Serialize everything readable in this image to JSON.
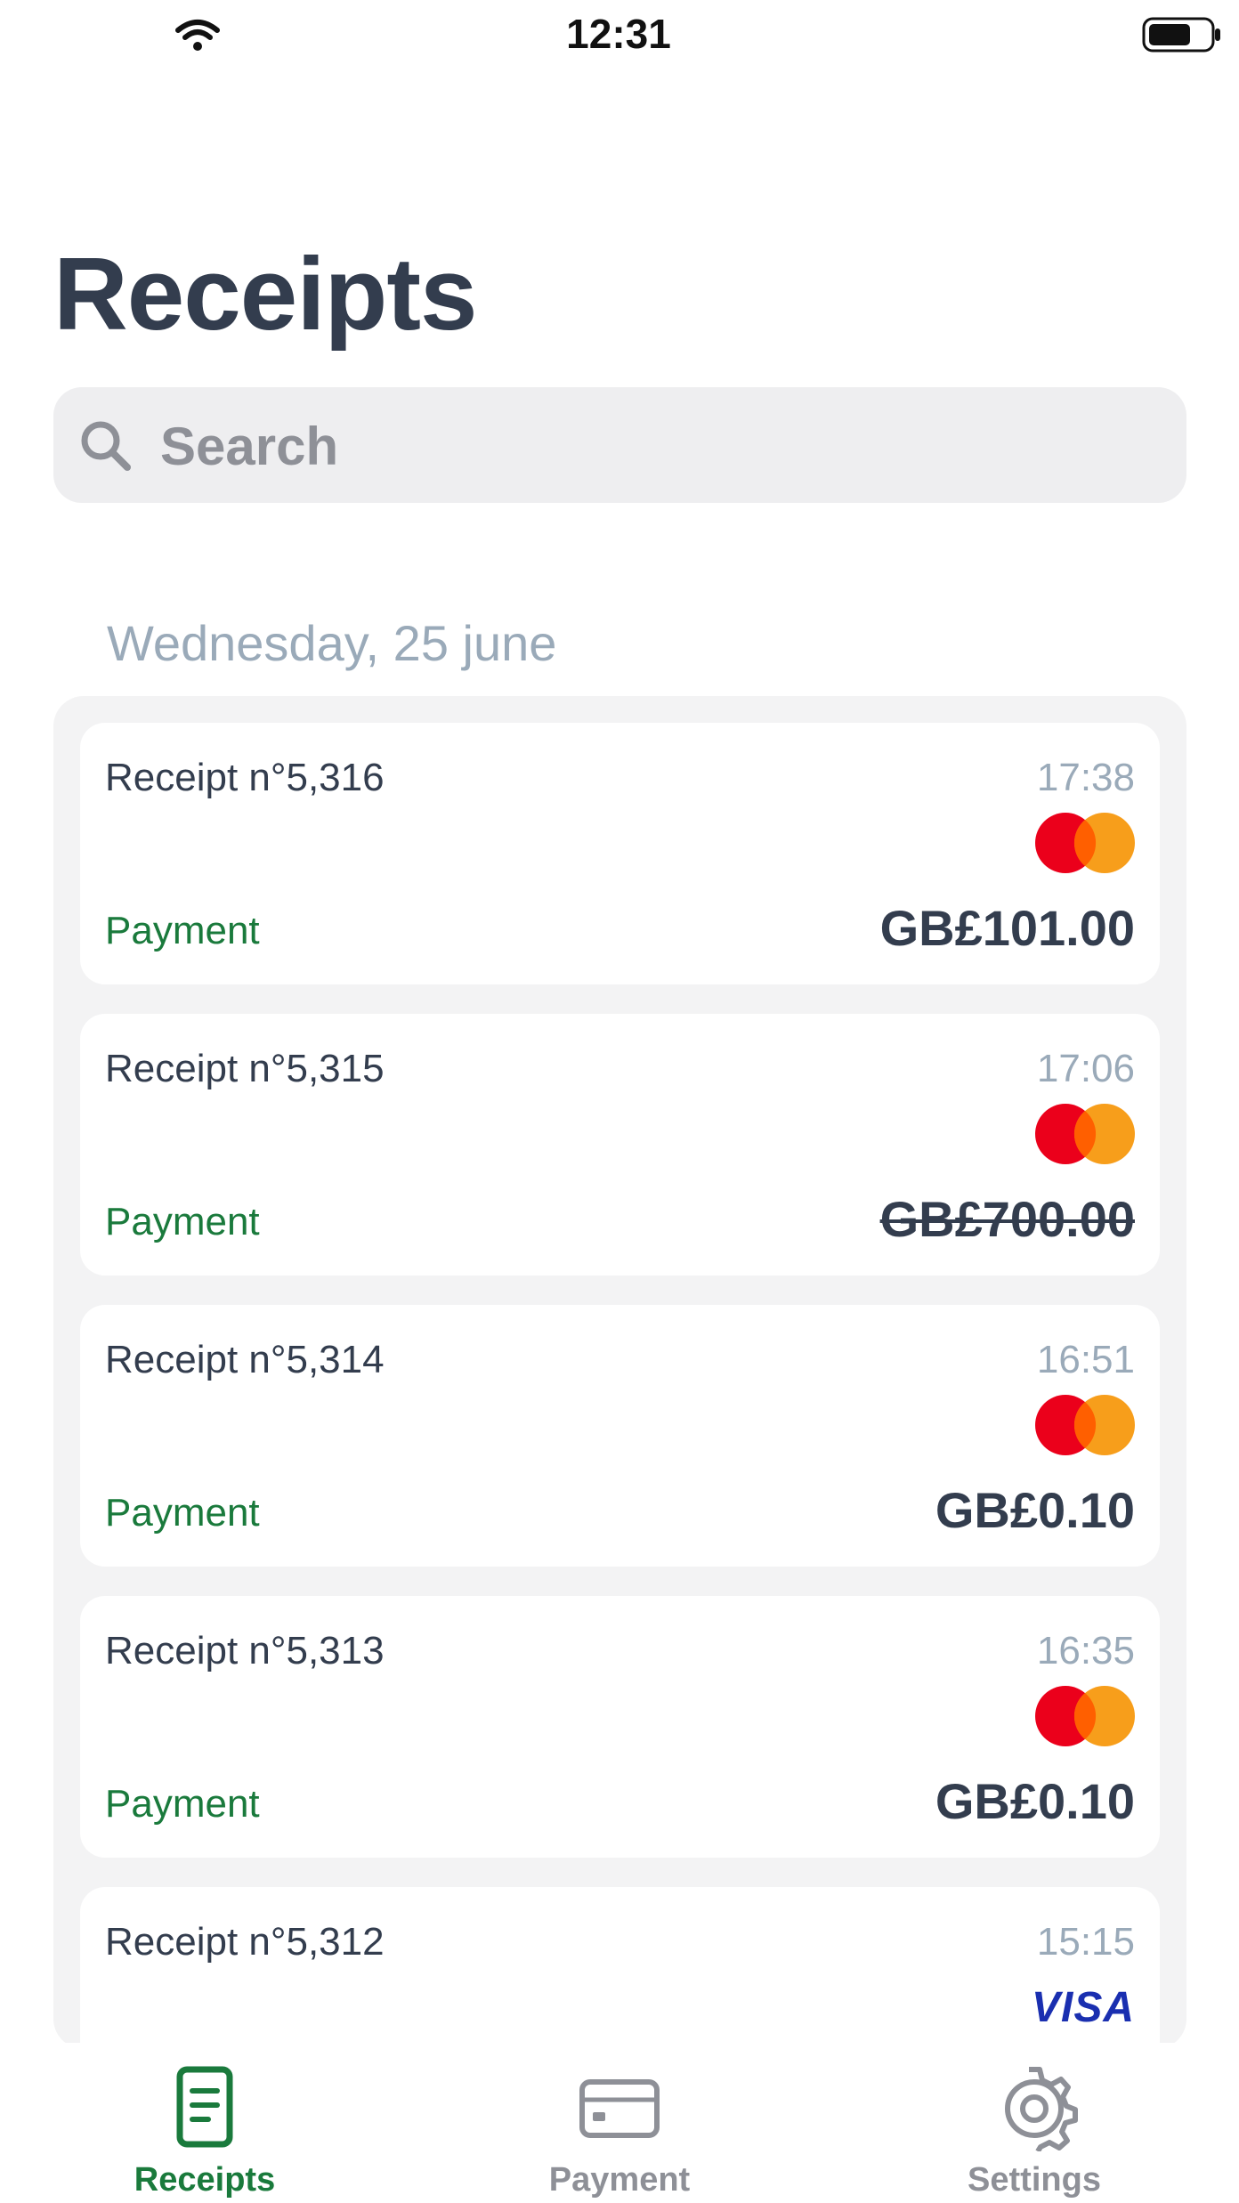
{
  "status_bar": {
    "time": "12:31",
    "icons": [
      "wifi-icon",
      "battery-icon"
    ]
  },
  "title": "Receipts",
  "search": {
    "placeholder": "Search",
    "icon": "search-icon"
  },
  "section": {
    "date": "Wednesday, 25 june"
  },
  "receipts": [
    {
      "number": "Receipt n°5,316",
      "time": "17:38",
      "type": "Payment",
      "amount": "GB£101.00",
      "card_brand": "mastercard",
      "voided": false
    },
    {
      "number": "Receipt n°5,315",
      "time": "17:06",
      "type": "Payment",
      "amount": "GB£700.00",
      "card_brand": "mastercard",
      "voided": true
    },
    {
      "number": "Receipt n°5,314",
      "time": "16:51",
      "type": "Payment",
      "amount": "GB£0.10",
      "card_brand": "mastercard",
      "voided": false
    },
    {
      "number": "Receipt n°5,313",
      "time": "16:35",
      "type": "Payment",
      "amount": "GB£0.10",
      "card_brand": "mastercard",
      "voided": false
    },
    {
      "number": "Receipt n°5,312",
      "time": "15:15",
      "card_brand": "visa",
      "brand_label": "VISA",
      "voided": false
    }
  ],
  "tab_bar": {
    "tabs": [
      {
        "label": "Receipts",
        "icon": "receipt-icon",
        "active": true
      },
      {
        "label": "Payment",
        "icon": "card-icon",
        "active": false
      },
      {
        "label": "Settings",
        "icon": "gear-icon",
        "active": false
      }
    ]
  },
  "colors": {
    "title": "#333d4e",
    "accent_green": "#1a7a3c",
    "muted": "#9aaab9",
    "inactive_tab": "#8e9097",
    "search_bg": "#eeeef0",
    "mastercard_red": "#eb001b",
    "mastercard_orange": "#f79e1b",
    "visa_blue": "#1a2fb0"
  }
}
